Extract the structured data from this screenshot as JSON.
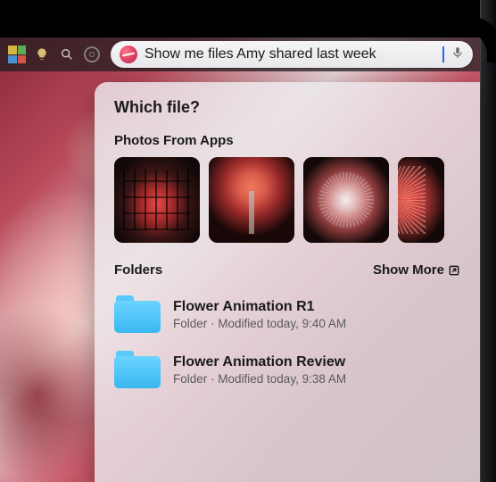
{
  "menubar": {
    "icons": [
      "activity-blocks-icon",
      "lightbulb-icon",
      "magnifier-icon",
      "target-icon"
    ]
  },
  "search": {
    "value": "Show me files Amy shared last week"
  },
  "panel": {
    "prompt": "Which file?",
    "photos_section": "Photos From Apps",
    "folders_section": "Folders",
    "show_more": "Show More",
    "folders": [
      {
        "name": "Flower Animation R1",
        "meta": "Folder · Modified today, 9:40 AM"
      },
      {
        "name": "Flower Animation Review",
        "meta": "Folder · Modified today, 9:38 AM"
      }
    ]
  }
}
